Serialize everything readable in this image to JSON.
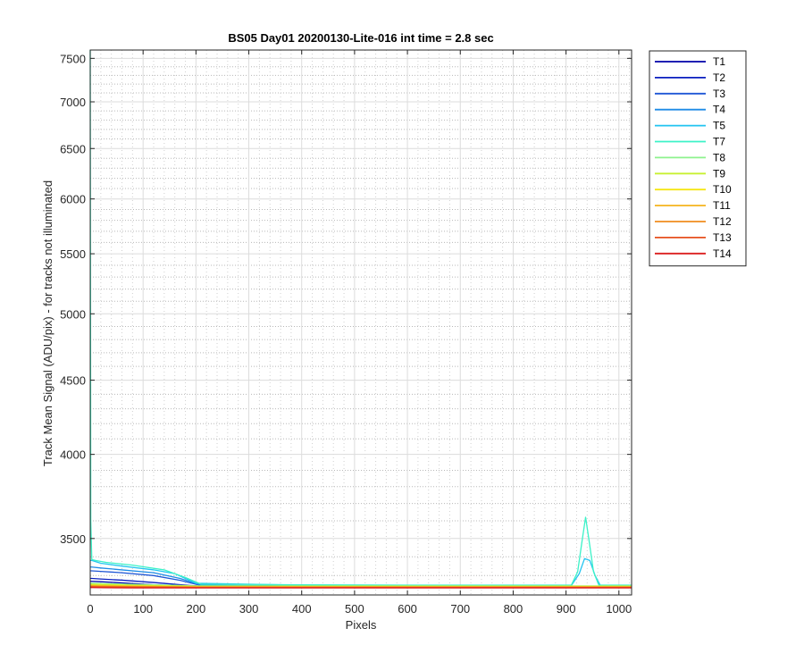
{
  "chart_data": {
    "type": "line",
    "title": "BS05 Day01 20200130-Lite-016 int time = 2.8 sec",
    "xlabel": "Pixels",
    "ylabel": "Track Mean Signal (ADU/pix) - for tracks not illuminated",
    "xlim": [
      0,
      1024
    ],
    "ylim": [
      3200,
      7600
    ],
    "y_scale": "log",
    "xticks": [
      0,
      100,
      200,
      300,
      400,
      500,
      600,
      700,
      800,
      900,
      1000
    ],
    "yticks": [
      3500,
      4000,
      4500,
      5000,
      5500,
      6000,
      6500,
      7000,
      7500
    ],
    "grid": true,
    "minor_grid": true,
    "legend_position": "outside-right",
    "series": [
      {
        "name": "T1",
        "color": "#0000a8",
        "x": [
          0,
          3,
          20,
          60,
          120,
          180,
          220,
          400,
          700,
          1024
        ],
        "y": [
          3270,
          3270,
          3268,
          3262,
          3252,
          3244,
          3240,
          3240,
          3240,
          3240
        ]
      },
      {
        "name": "T2",
        "color": "#0a1fbf",
        "x": [
          0,
          3,
          20,
          60,
          120,
          180,
          220,
          400,
          700,
          1024
        ],
        "y": [
          3285,
          3285,
          3282,
          3276,
          3264,
          3250,
          3242,
          3242,
          3242,
          3242
        ]
      },
      {
        "name": "T3",
        "color": "#1e56d6",
        "x": [
          0,
          3,
          20,
          60,
          120,
          170,
          210,
          400,
          700,
          1024
        ],
        "y": [
          3325,
          3325,
          3322,
          3315,
          3300,
          3275,
          3248,
          3245,
          3244,
          3244
        ]
      },
      {
        "name": "T4",
        "color": "#1e8be6",
        "x": [
          0,
          3,
          20,
          60,
          120,
          170,
          210,
          400,
          700,
          1024
        ],
        "y": [
          3345,
          3345,
          3340,
          3330,
          3315,
          3285,
          3250,
          3246,
          3245,
          3245
        ]
      },
      {
        "name": "T5",
        "color": "#22c4f0",
        "x": [
          0,
          3,
          20,
          60,
          120,
          160,
          200,
          400,
          700,
          910,
          925,
          935,
          945,
          955,
          965,
          1024
        ],
        "y": [
          3380,
          3380,
          3365,
          3350,
          3330,
          3310,
          3260,
          3250,
          3248,
          3248,
          3310,
          3390,
          3380,
          3300,
          3248,
          3248
        ]
      },
      {
        "name": "T7",
        "color": "#3cf2c8",
        "x": [
          0,
          1,
          3,
          10,
          30,
          80,
          140,
          180,
          210,
          400,
          600,
          910,
          922,
          930,
          937,
          944,
          952,
          962,
          1024
        ],
        "y": [
          7600,
          3600,
          3385,
          3380,
          3370,
          3355,
          3330,
          3290,
          3255,
          3252,
          3250,
          3250,
          3320,
          3480,
          3620,
          3480,
          3320,
          3250,
          3250
        ]
      },
      {
        "name": "T8",
        "color": "#8cf28c",
        "x": [
          0,
          3,
          20,
          80,
          150,
          200,
          400,
          1024
        ],
        "y": [
          3260,
          3260,
          3258,
          3254,
          3250,
          3246,
          3246,
          3246
        ]
      },
      {
        "name": "T9",
        "color": "#c8f032",
        "x": [
          0,
          3,
          20,
          80,
          150,
          200,
          400,
          1024
        ],
        "y": [
          3255,
          3255,
          3254,
          3250,
          3247,
          3245,
          3245,
          3245
        ]
      },
      {
        "name": "T10",
        "color": "#f5e614",
        "x": [
          0,
          3,
          20,
          80,
          150,
          200,
          400,
          1024
        ],
        "y": [
          3250,
          3250,
          3249,
          3247,
          3245,
          3243,
          3243,
          3243
        ]
      },
      {
        "name": "T11",
        "color": "#f5b41e",
        "x": [
          0,
          3,
          20,
          80,
          150,
          200,
          400,
          1024
        ],
        "y": [
          3248,
          3248,
          3247,
          3245,
          3243,
          3242,
          3242,
          3242
        ]
      },
      {
        "name": "T12",
        "color": "#f08c1e",
        "x": [
          0,
          3,
          20,
          80,
          150,
          200,
          400,
          1024
        ],
        "y": [
          3245,
          3245,
          3244,
          3242,
          3241,
          3240,
          3240,
          3240
        ]
      },
      {
        "name": "T13",
        "color": "#e6501e",
        "x": [
          0,
          3,
          20,
          80,
          150,
          200,
          400,
          1024
        ],
        "y": [
          3242,
          3242,
          3241,
          3240,
          3239,
          3238,
          3238,
          3238
        ]
      },
      {
        "name": "T14",
        "color": "#dc1e1e",
        "x": [
          0,
          3,
          20,
          80,
          150,
          200,
          400,
          1024
        ],
        "y": [
          3238,
          3238,
          3237,
          3236,
          3236,
          3236,
          3236,
          3236
        ]
      }
    ]
  }
}
